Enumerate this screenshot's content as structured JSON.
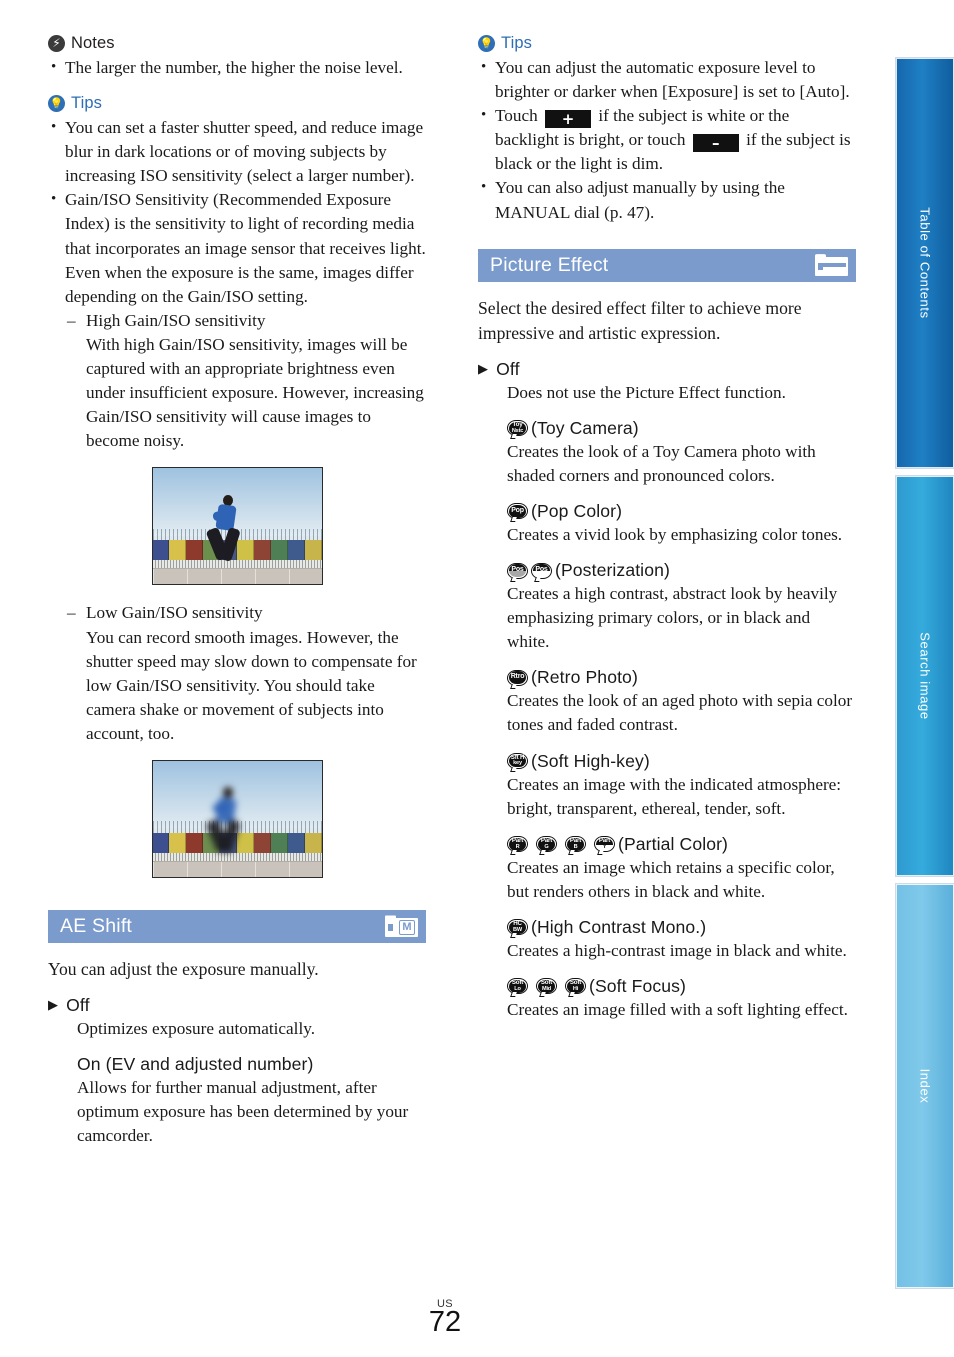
{
  "page": {
    "locale_label": "US",
    "number": "72"
  },
  "left_column": {
    "notes": {
      "icon": "notes-bolt-icon",
      "label": "Notes",
      "items": [
        "The larger the number, the higher the noise level."
      ]
    },
    "tips": {
      "icon": "tips-bulb-icon",
      "label": "Tips",
      "items": [
        "You can set a faster shutter speed, and reduce image blur in dark locations or of moving subjects by increasing ISO sensitivity (select a larger number).",
        "Gain/ISO Sensitivity (Recommended Exposure Index) is the sensitivity to light of recording media that incorporates an image sensor that receives light. Even when the exposure is the same, images differ depending on the Gain/ISO setting."
      ],
      "sub_items": [
        {
          "term": "High Gain/ISO sensitivity",
          "text": "With high Gain/ISO sensitivity, images will be captured with an appropriate brightness even under insufficient exposure. However, increasing Gain/ISO sensitivity will cause images to become noisy.",
          "figure": "photo-runner-sharp"
        },
        {
          "term": "Low Gain/ISO sensitivity",
          "text": "You can record smooth images. However, the shutter speed may slow down to compensate for low Gain/ISO sensitivity. You should take camera shake or movement of subjects into account, too.",
          "figure": "photo-runner-blurred"
        }
      ]
    },
    "ae_shift": {
      "header": {
        "title": "AE Shift",
        "icon": "camcorder-manual-icon",
        "icon_label": "M",
        "bar_color": "#7b9bcd"
      },
      "intro": "You can adjust the exposure manually.",
      "options": [
        {
          "marker": "▶",
          "title": "Off",
          "desc": "Optimizes exposure automatically."
        },
        {
          "marker": "",
          "title": "On (EV and adjusted number)",
          "desc": "Allows for further manual adjustment, after optimum exposure has been determined by your camcorder."
        }
      ]
    }
  },
  "right_column": {
    "tips": {
      "icon": "tips-bulb-icon",
      "label": "Tips",
      "items": [
        {
          "text_before": "You can adjust the automatic exposure level to brighter or darker when [Exposure] is set to [Auto].",
          "keys": []
        },
        {
          "text_before": "Touch ",
          "key1": "+",
          "text_middle": " if the subject is white or the backlight is bright, or touch ",
          "key2": "–",
          "text_after": " if the subject is black or the light is dim."
        },
        {
          "text_before": "You can also adjust manually by using the MANUAL dial (p. 47).",
          "keys": []
        }
      ]
    },
    "picture_effect": {
      "header": {
        "title": "Picture Effect",
        "icon": "camcorder-icon",
        "bar_color": "#7b9bcd"
      },
      "intro": "Select the desired effect filter to achieve more impressive and artistic expression.",
      "options": [
        {
          "marker": "▶",
          "badges": [],
          "title": "Off",
          "desc": "Does not use the Picture Effect function."
        },
        {
          "marker": "",
          "badges": [
            {
              "line1": "Toy",
              "line2": "Nstc",
              "style": "solid"
            }
          ],
          "title": "(Toy Camera)",
          "desc": "Creates the look of a Toy Camera photo with shaded corners and pronounced colors."
        },
        {
          "marker": "",
          "badges": [
            {
              "line1": "Pop",
              "line2": "",
              "style": "one"
            }
          ],
          "title": "(Pop Color)",
          "desc": "Creates a vivid look by emphasizing color tones."
        },
        {
          "marker": "",
          "badges": [
            {
              "line1": "Pos",
              "line2": "",
              "style": "dimBot"
            },
            {
              "line1": "Pos",
              "line2": "",
              "style": "splitTB"
            }
          ],
          "title": "(Posterization)",
          "desc": "Creates a high contrast, abstract look by heavily emphasizing primary colors, or in black and white."
        },
        {
          "marker": "",
          "badges": [
            {
              "line1": "Rtro",
              "line2": "",
              "style": "one"
            }
          ],
          "title": "(Retro Photo)",
          "desc": "Creates the look of an aged photo with sepia color tones and faded contrast."
        },
        {
          "marker": "",
          "badges": [
            {
              "line1": "Sft H",
              "line2": "key",
              "style": "solid"
            }
          ],
          "title": "(Soft High-key)",
          "desc": "Creates an image with the indicated atmosphere: bright, transparent, ethereal, tender, soft."
        },
        {
          "marker": "",
          "badges": [
            {
              "line1": "Part",
              "line2": "R",
              "style": "solid"
            },
            {
              "line1": "Part",
              "line2": "G",
              "style": "solid"
            },
            {
              "line1": "Part",
              "line2": "B",
              "style": "solid"
            },
            {
              "line1": "Part",
              "line2": "Y",
              "style": "splitTB"
            }
          ],
          "title": "(Partial Color)",
          "desc": "Creates an image which retains a specific color, but renders others in black and white."
        },
        {
          "marker": "",
          "badges": [
            {
              "line1": "HC",
              "line2": "BW",
              "style": "solid"
            }
          ],
          "title": "(High Contrast Mono.)",
          "desc": "Creates a high-contrast image in black and white."
        },
        {
          "marker": "",
          "badges": [
            {
              "line1": "Soft",
              "line2": "Lo",
              "style": "solid"
            },
            {
              "line1": "Soft",
              "line2": "Mid",
              "style": "solid"
            },
            {
              "line1": "Soft",
              "line2": "Hi",
              "style": "solid"
            }
          ],
          "title": "(Soft Focus)",
          "desc": "Creates an image filled with a soft lighting effect."
        }
      ]
    }
  },
  "side_tabs": [
    {
      "id": "toc",
      "label": "Table of Contents",
      "color": "#1668ad"
    },
    {
      "id": "search",
      "label": "Search image",
      "color": "#2e9ad0"
    },
    {
      "id": "index",
      "label": "Index",
      "color": "#74c1e6"
    }
  ]
}
